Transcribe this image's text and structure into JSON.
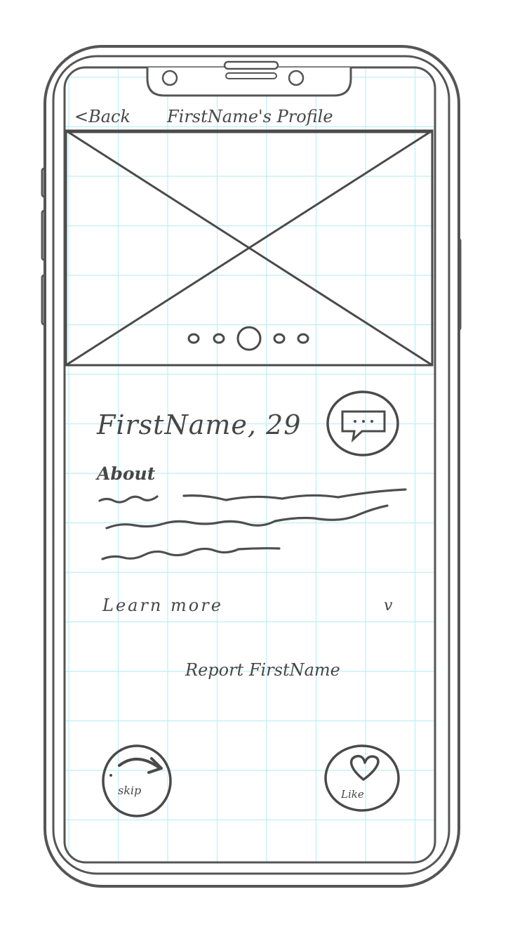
{
  "nav": {
    "back_label": "<Back",
    "title": "FirstName's Profile"
  },
  "photo_carousel": {
    "image_placeholder_icon": "x-placeholder-icon",
    "page_dot_count": 5,
    "active_page": 3
  },
  "profile": {
    "name_age": "FirstName, 29",
    "message_icon": "chat-bubble-icon"
  },
  "about": {
    "heading": "About",
    "body_placeholder_lines": 3
  },
  "learn_more": {
    "label": "Learn more",
    "chevron": "v",
    "chevron_icon": "chevron-down-icon"
  },
  "report": {
    "label": "Report FirstName"
  },
  "actions": {
    "skip_label": "skip",
    "skip_icon": "curved-arrow-icon",
    "like_label": "Like",
    "like_icon": "heart-icon"
  },
  "colors": {
    "ink": "#474747",
    "grid": "#bfeef2"
  }
}
